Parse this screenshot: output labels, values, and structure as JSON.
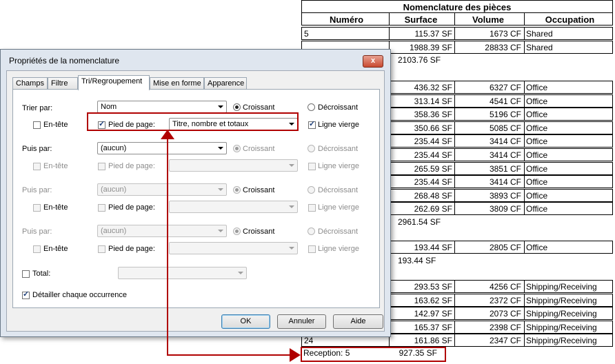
{
  "schedule": {
    "title": "Nomenclature des pièces",
    "headers": [
      "Numéro",
      "Surface",
      "Volume",
      "Occupation"
    ],
    "rows": [
      {
        "numero": "5",
        "surface": "115.37 SF",
        "volume": "1673 CF",
        "occupation": "Shared"
      },
      {
        "numero": "",
        "surface": "1988.39 SF",
        "volume": "28833 CF",
        "occupation": "Shared"
      }
    ],
    "subtotal1": "2103.76 SF",
    "office_rows": [
      {
        "surface": "436.32 SF",
        "volume": "6327 CF",
        "occupation": "Office"
      },
      {
        "surface": "313.14 SF",
        "volume": "4541 CF",
        "occupation": "Office"
      },
      {
        "surface": "358.36 SF",
        "volume": "5196 CF",
        "occupation": "Office"
      },
      {
        "surface": "350.66 SF",
        "volume": "5085 CF",
        "occupation": "Office"
      },
      {
        "surface": "235.44 SF",
        "volume": "3414 CF",
        "occupation": "Office"
      },
      {
        "surface": "235.44 SF",
        "volume": "3414 CF",
        "occupation": "Office"
      },
      {
        "surface": "265.59 SF",
        "volume": "3851 CF",
        "occupation": "Office"
      },
      {
        "surface": "235.44 SF",
        "volume": "3414 CF",
        "occupation": "Office"
      },
      {
        "surface": "268.48 SF",
        "volume": "3893 CF",
        "occupation": "Office"
      },
      {
        "surface": "262.69 SF",
        "volume": "3809 CF",
        "occupation": "Office"
      }
    ],
    "subtotal2": "2961.54 SF",
    "office_row2": {
      "surface": "193.44 SF",
      "volume": "2805 CF",
      "occupation": "Office"
    },
    "subtotal3": "193.44 SF",
    "shipping_rows": [
      {
        "numero": "",
        "surface": "293.53 SF",
        "volume": "4256 CF",
        "occupation": "Shipping/Receiving"
      },
      {
        "numero": "",
        "surface": "163.62 SF",
        "volume": "2372 CF",
        "occupation": "Shipping/Receiving"
      },
      {
        "numero": "",
        "surface": "142.97 SF",
        "volume": "2073 CF",
        "occupation": "Shipping/Receiving"
      },
      {
        "numero": "",
        "surface": "165.37 SF",
        "volume": "2398 CF",
        "occupation": "Shipping/Receiving"
      },
      {
        "numero": "24",
        "surface": "161.86 SF",
        "volume": "2347 CF",
        "occupation": "Shipping/Receiving"
      }
    ],
    "footer_label": "Reception: 5",
    "footer_total": "927.35 SF"
  },
  "dialog": {
    "title": "Propriétés de la nomenclature",
    "tabs": [
      "Champs",
      "Filtre",
      "Tri/Regroupement",
      "Mise en forme",
      "Apparence"
    ],
    "active_tab": "Tri/Regroupement",
    "sort_label": "Trier par:",
    "then_label": "Puis par:",
    "sort_value": "Nom",
    "none_value": "(aucun)",
    "ascending": "Croissant",
    "descending": "Décroissant",
    "header": "En-tête",
    "footer": "Pied de page:",
    "footer_value": "Titre, nombre et totaux",
    "blank_line": "Ligne vierge",
    "total_label": "Total:",
    "itemize_label": "Détailler chaque occurrence",
    "ok": "OK",
    "cancel": "Annuler",
    "help": "Aide",
    "close_glyph": "x",
    "check_glyph": "✓"
  },
  "colors": {
    "highlight": "#b00000",
    "dialog_frame": "#dfe6ef"
  }
}
